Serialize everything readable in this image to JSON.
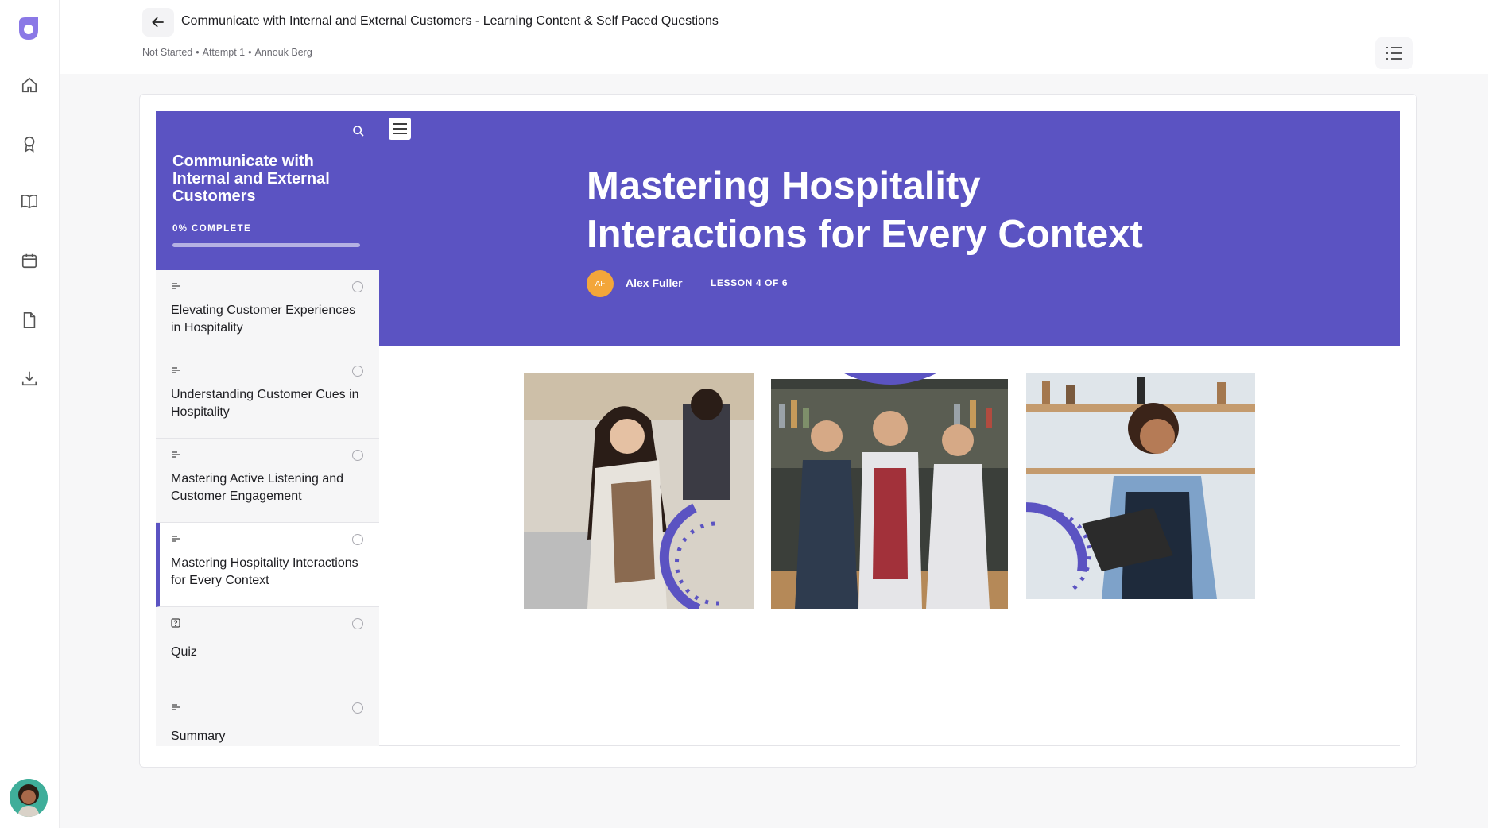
{
  "header": {
    "course_title": "Communicate with Internal and External Customers - Learning Content & Self Paced Questions",
    "status": "Not Started",
    "attempt": "Attempt 1",
    "user": "Annouk Berg"
  },
  "rail": {
    "items": [
      "home-icon",
      "award-icon",
      "book-icon",
      "calendar-icon",
      "file-icon",
      "download-icon"
    ]
  },
  "sidebar": {
    "course_title": "Communicate with Internal and External Customers",
    "progress_label": "0% COMPLETE",
    "progress_percent": 0,
    "lessons": [
      {
        "label": "Elevating Customer Experiences in Hospitality",
        "type": "text-icon"
      },
      {
        "label": "Understanding Customer Cues in Hospitality",
        "type": "text-icon"
      },
      {
        "label": "Mastering Active Listening and Customer Engagement",
        "type": "text-icon"
      },
      {
        "label": "Mastering Hospitality Interactions for Every Context",
        "type": "text-icon",
        "active": true
      },
      {
        "label": "Quiz",
        "type": "quiz-icon"
      },
      {
        "label": "Summary",
        "type": "text-icon"
      }
    ]
  },
  "lesson": {
    "title": "Mastering Hospitality Interactions for Every Context",
    "author_initials": "AF",
    "author_name": "Alex Fuller",
    "lesson_count": "LESSON 4 OF 6"
  },
  "colors": {
    "accent": "#5b53c2",
    "author_badge": "#f3a63a"
  }
}
